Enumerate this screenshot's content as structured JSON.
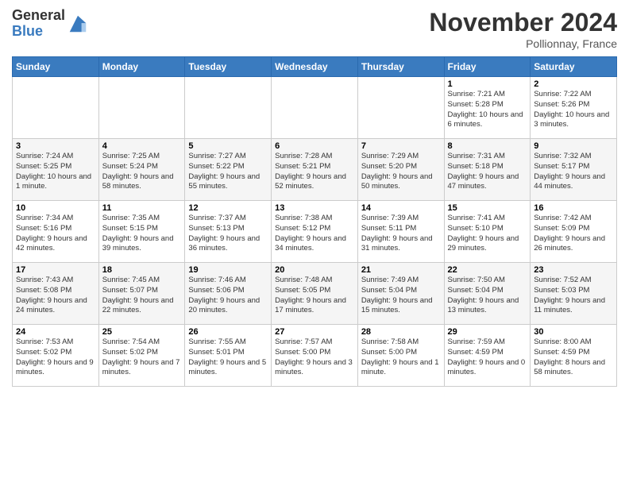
{
  "logo": {
    "general": "General",
    "blue": "Blue"
  },
  "header": {
    "month": "November 2024",
    "location": "Pollionnay, France"
  },
  "weekdays": [
    "Sunday",
    "Monday",
    "Tuesday",
    "Wednesday",
    "Thursday",
    "Friday",
    "Saturday"
  ],
  "weeks": [
    [
      {
        "day": "",
        "sunrise": "",
        "sunset": "",
        "daylight": ""
      },
      {
        "day": "",
        "sunrise": "",
        "sunset": "",
        "daylight": ""
      },
      {
        "day": "",
        "sunrise": "",
        "sunset": "",
        "daylight": ""
      },
      {
        "day": "",
        "sunrise": "",
        "sunset": "",
        "daylight": ""
      },
      {
        "day": "",
        "sunrise": "",
        "sunset": "",
        "daylight": ""
      },
      {
        "day": "1",
        "sunrise": "Sunrise: 7:21 AM",
        "sunset": "Sunset: 5:28 PM",
        "daylight": "Daylight: 10 hours and 6 minutes."
      },
      {
        "day": "2",
        "sunrise": "Sunrise: 7:22 AM",
        "sunset": "Sunset: 5:26 PM",
        "daylight": "Daylight: 10 hours and 3 minutes."
      }
    ],
    [
      {
        "day": "3",
        "sunrise": "Sunrise: 7:24 AM",
        "sunset": "Sunset: 5:25 PM",
        "daylight": "Daylight: 10 hours and 1 minute."
      },
      {
        "day": "4",
        "sunrise": "Sunrise: 7:25 AM",
        "sunset": "Sunset: 5:24 PM",
        "daylight": "Daylight: 9 hours and 58 minutes."
      },
      {
        "day": "5",
        "sunrise": "Sunrise: 7:27 AM",
        "sunset": "Sunset: 5:22 PM",
        "daylight": "Daylight: 9 hours and 55 minutes."
      },
      {
        "day": "6",
        "sunrise": "Sunrise: 7:28 AM",
        "sunset": "Sunset: 5:21 PM",
        "daylight": "Daylight: 9 hours and 52 minutes."
      },
      {
        "day": "7",
        "sunrise": "Sunrise: 7:29 AM",
        "sunset": "Sunset: 5:20 PM",
        "daylight": "Daylight: 9 hours and 50 minutes."
      },
      {
        "day": "8",
        "sunrise": "Sunrise: 7:31 AM",
        "sunset": "Sunset: 5:18 PM",
        "daylight": "Daylight: 9 hours and 47 minutes."
      },
      {
        "day": "9",
        "sunrise": "Sunrise: 7:32 AM",
        "sunset": "Sunset: 5:17 PM",
        "daylight": "Daylight: 9 hours and 44 minutes."
      }
    ],
    [
      {
        "day": "10",
        "sunrise": "Sunrise: 7:34 AM",
        "sunset": "Sunset: 5:16 PM",
        "daylight": "Daylight: 9 hours and 42 minutes."
      },
      {
        "day": "11",
        "sunrise": "Sunrise: 7:35 AM",
        "sunset": "Sunset: 5:15 PM",
        "daylight": "Daylight: 9 hours and 39 minutes."
      },
      {
        "day": "12",
        "sunrise": "Sunrise: 7:37 AM",
        "sunset": "Sunset: 5:13 PM",
        "daylight": "Daylight: 9 hours and 36 minutes."
      },
      {
        "day": "13",
        "sunrise": "Sunrise: 7:38 AM",
        "sunset": "Sunset: 5:12 PM",
        "daylight": "Daylight: 9 hours and 34 minutes."
      },
      {
        "day": "14",
        "sunrise": "Sunrise: 7:39 AM",
        "sunset": "Sunset: 5:11 PM",
        "daylight": "Daylight: 9 hours and 31 minutes."
      },
      {
        "day": "15",
        "sunrise": "Sunrise: 7:41 AM",
        "sunset": "Sunset: 5:10 PM",
        "daylight": "Daylight: 9 hours and 29 minutes."
      },
      {
        "day": "16",
        "sunrise": "Sunrise: 7:42 AM",
        "sunset": "Sunset: 5:09 PM",
        "daylight": "Daylight: 9 hours and 26 minutes."
      }
    ],
    [
      {
        "day": "17",
        "sunrise": "Sunrise: 7:43 AM",
        "sunset": "Sunset: 5:08 PM",
        "daylight": "Daylight: 9 hours and 24 minutes."
      },
      {
        "day": "18",
        "sunrise": "Sunrise: 7:45 AM",
        "sunset": "Sunset: 5:07 PM",
        "daylight": "Daylight: 9 hours and 22 minutes."
      },
      {
        "day": "19",
        "sunrise": "Sunrise: 7:46 AM",
        "sunset": "Sunset: 5:06 PM",
        "daylight": "Daylight: 9 hours and 20 minutes."
      },
      {
        "day": "20",
        "sunrise": "Sunrise: 7:48 AM",
        "sunset": "Sunset: 5:05 PM",
        "daylight": "Daylight: 9 hours and 17 minutes."
      },
      {
        "day": "21",
        "sunrise": "Sunrise: 7:49 AM",
        "sunset": "Sunset: 5:04 PM",
        "daylight": "Daylight: 9 hours and 15 minutes."
      },
      {
        "day": "22",
        "sunrise": "Sunrise: 7:50 AM",
        "sunset": "Sunset: 5:04 PM",
        "daylight": "Daylight: 9 hours and 13 minutes."
      },
      {
        "day": "23",
        "sunrise": "Sunrise: 7:52 AM",
        "sunset": "Sunset: 5:03 PM",
        "daylight": "Daylight: 9 hours and 11 minutes."
      }
    ],
    [
      {
        "day": "24",
        "sunrise": "Sunrise: 7:53 AM",
        "sunset": "Sunset: 5:02 PM",
        "daylight": "Daylight: 9 hours and 9 minutes."
      },
      {
        "day": "25",
        "sunrise": "Sunrise: 7:54 AM",
        "sunset": "Sunset: 5:02 PM",
        "daylight": "Daylight: 9 hours and 7 minutes."
      },
      {
        "day": "26",
        "sunrise": "Sunrise: 7:55 AM",
        "sunset": "Sunset: 5:01 PM",
        "daylight": "Daylight: 9 hours and 5 minutes."
      },
      {
        "day": "27",
        "sunrise": "Sunrise: 7:57 AM",
        "sunset": "Sunset: 5:00 PM",
        "daylight": "Daylight: 9 hours and 3 minutes."
      },
      {
        "day": "28",
        "sunrise": "Sunrise: 7:58 AM",
        "sunset": "Sunset: 5:00 PM",
        "daylight": "Daylight: 9 hours and 1 minute."
      },
      {
        "day": "29",
        "sunrise": "Sunrise: 7:59 AM",
        "sunset": "Sunset: 4:59 PM",
        "daylight": "Daylight: 9 hours and 0 minutes."
      },
      {
        "day": "30",
        "sunrise": "Sunrise: 8:00 AM",
        "sunset": "Sunset: 4:59 PM",
        "daylight": "Daylight: 8 hours and 58 minutes."
      }
    ]
  ]
}
